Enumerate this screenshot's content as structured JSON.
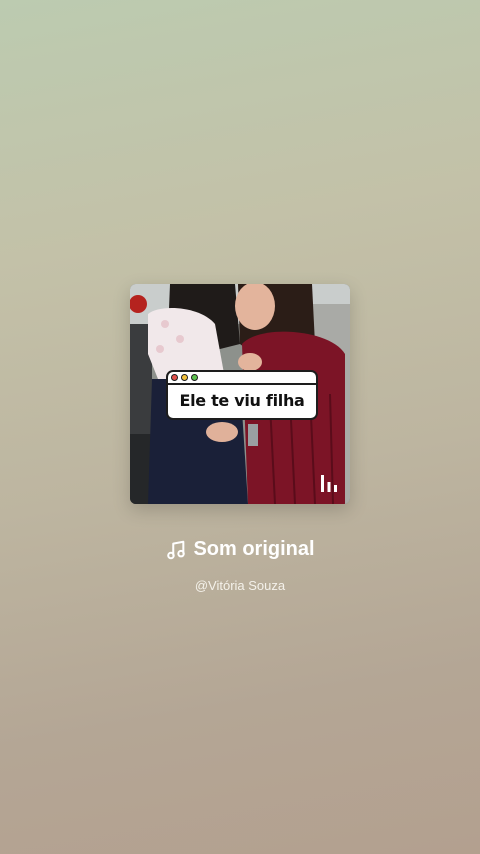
{
  "sound": {
    "title": "Som original",
    "author": "@Vitória Souza"
  },
  "cover": {
    "caption": "Ele te viu filha",
    "window_dot_colors": [
      "#e0504a",
      "#f2c13b",
      "#5cc24e"
    ],
    "icon": "audio-bars-icon"
  },
  "icons": {
    "title_icon": "music-note-icon"
  }
}
